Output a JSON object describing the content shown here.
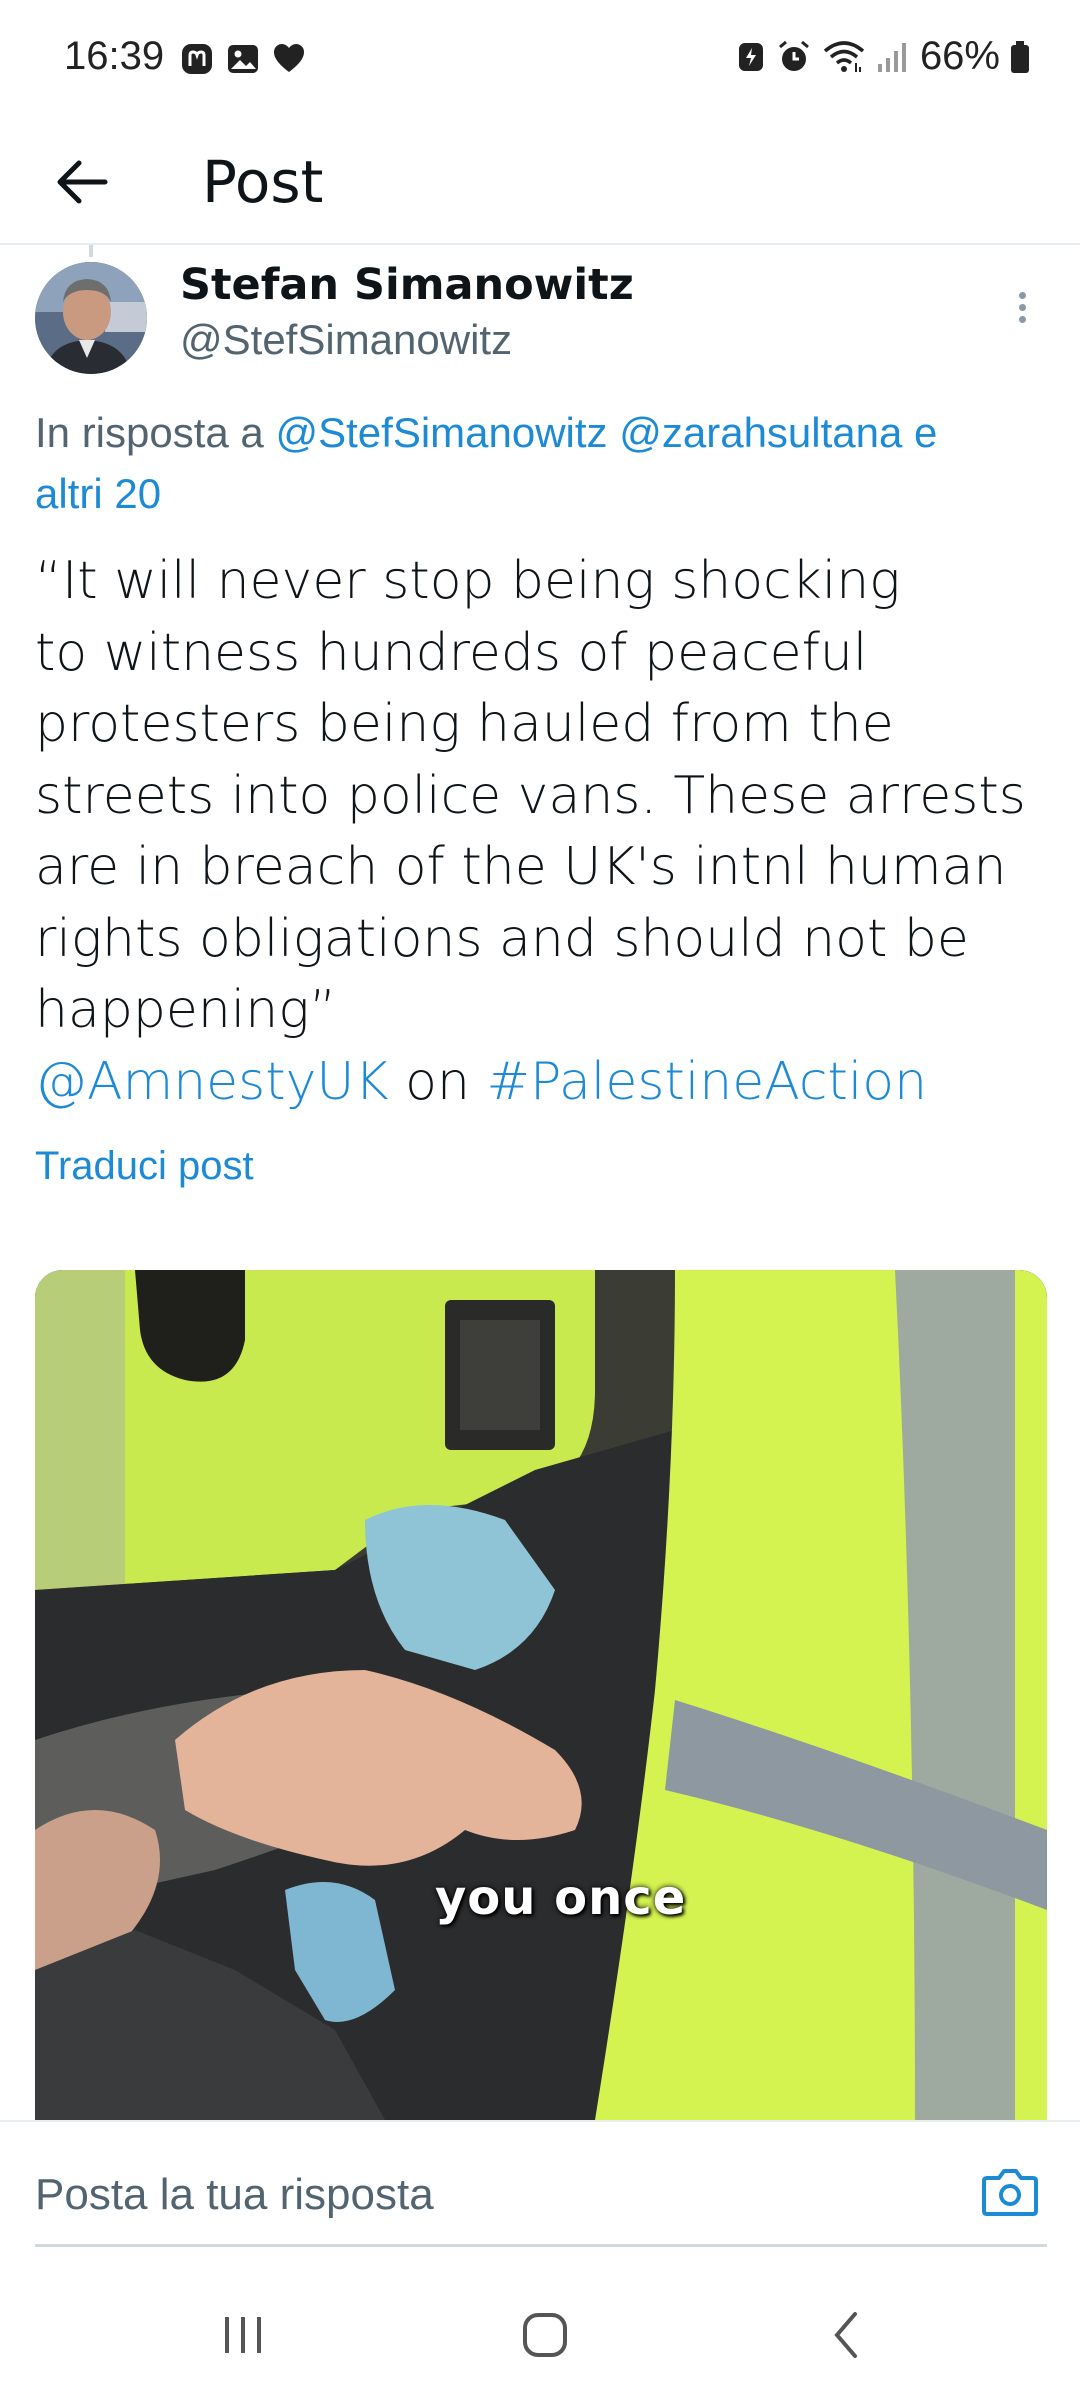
{
  "status_bar": {
    "time": "16:39",
    "battery_percent": "66%",
    "left_icons": [
      "mastodon-icon",
      "gallery-icon",
      "heart-icon"
    ],
    "right_icons": [
      "battery-saver-icon",
      "alarm-icon",
      "wifi-icon",
      "signal-icon",
      "battery-icon"
    ]
  },
  "header": {
    "title": "Post"
  },
  "post": {
    "author_name": "Stefan Simanowitz",
    "author_handle": "@StefSimanowitz",
    "reply_prefix": "In risposta a",
    "reply_mention_1": "@StefSimanowitz",
    "reply_mention_2": "@zarahsultana",
    "reply_suffix_word": "e",
    "reply_more": "altri 20",
    "text_lines": [
      "“It will never stop being shocking",
      "to witness hundreds of peaceful",
      "protesters being hauled from the",
      "streets into police vans. These arrests",
      "are in breach of the UK's intnl human",
      "rights obligations and should not be",
      "happening”"
    ],
    "mention_account": "@AmnestyUK",
    "mention_connector": "on",
    "hashtag": "#PalestineAction",
    "translate_label": "Traduci post",
    "media_subtitle": "you once"
  },
  "reply_bar": {
    "placeholder": "Posta la tua risposta"
  },
  "colors": {
    "link": "#1d9bf0",
    "text": "#0f1419",
    "secondary": "#536471",
    "divider": "#e6ecf0",
    "hiviz": "#c8f24a"
  }
}
